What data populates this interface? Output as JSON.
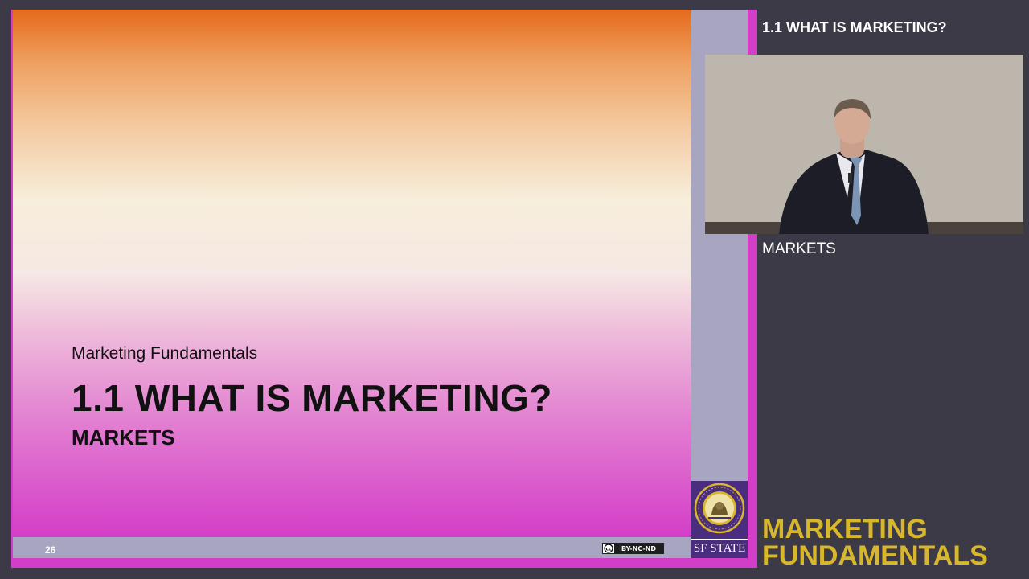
{
  "slide": {
    "course_name": "Marketing Fundamentals",
    "title": "1.1 WHAT IS MARKETING?",
    "subtitle": "MARKETS",
    "page_number": "26",
    "license_badge": "BY-NC-ND",
    "university_logo_text": "SF STATE"
  },
  "side_panel": {
    "heading": "1.1 WHAT IS MARKETING?",
    "section": "MARKETS",
    "brand_line1": "MARKETING",
    "brand_line2": "FUNDAMENTALS"
  },
  "icons": {
    "license": "creative-commons-icon",
    "seal": "university-seal-icon"
  },
  "colors": {
    "background": "#3b3a46",
    "brand_gold": "#d9b72c",
    "slide_orange": "#e56a1c",
    "slide_magenta": "#d33ec8",
    "slide_lavender": "#a7a5bf",
    "sfsu_purple": "#4b2d7f"
  }
}
